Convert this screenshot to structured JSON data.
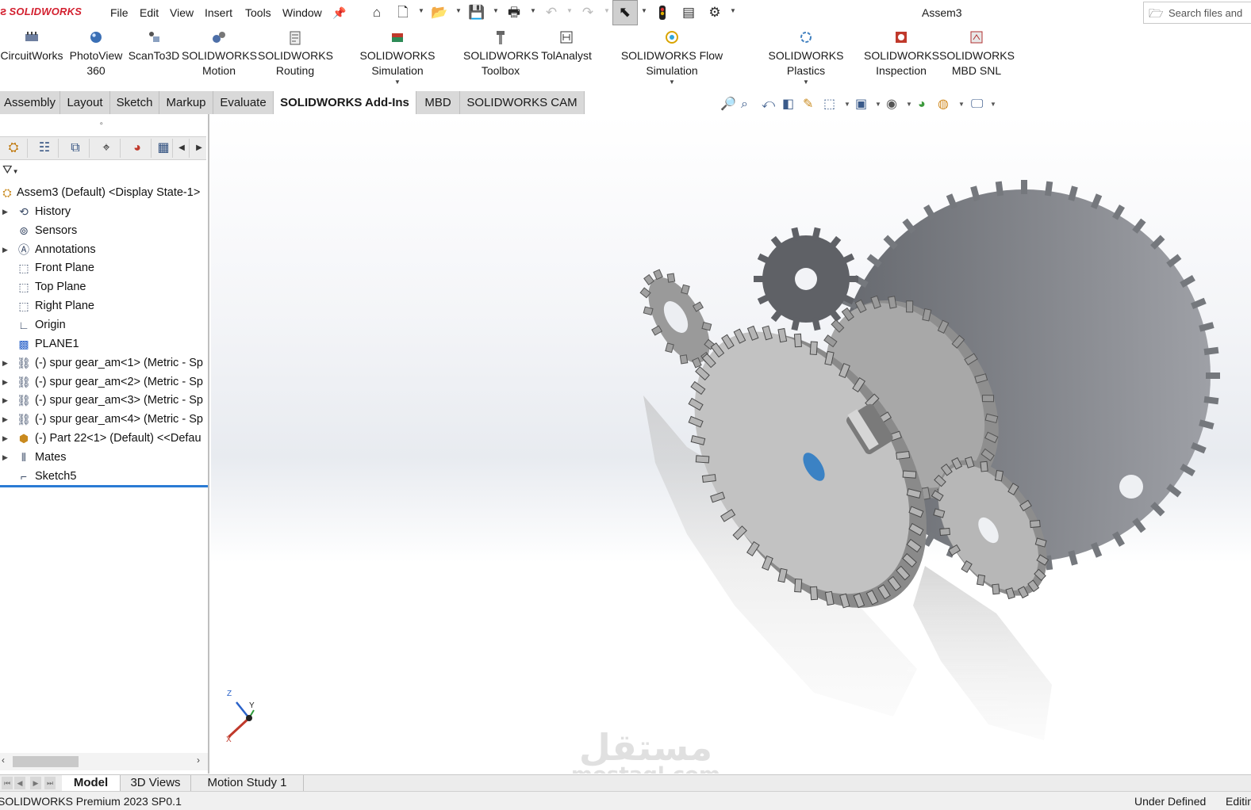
{
  "app": {
    "brand": "SOLIDWORKS",
    "document_title": "Assem3"
  },
  "menu": [
    "File",
    "Edit",
    "View",
    "Insert",
    "Tools",
    "Window"
  ],
  "search": {
    "placeholder": "Search files and"
  },
  "quick_access_icons": [
    "home-icon",
    "new-document-icon",
    "open-folder-icon",
    "save-icon",
    "print-icon",
    "undo-icon",
    "redo-icon",
    "select-cursor-icon",
    "rebuild-icon",
    "file-properties-icon",
    "options-gear-icon"
  ],
  "addins": [
    {
      "line1": "CircuitWorks",
      "line2": "",
      "icon": "circuit-icon"
    },
    {
      "line1": "PhotoView",
      "line2": "360",
      "icon": "photoview-sphere-icon"
    },
    {
      "line1": "ScanTo3D",
      "line2": "",
      "icon": "scan-icon"
    },
    {
      "line1": "SOLIDWORKS",
      "line2": "Motion",
      "icon": "motion-icon"
    },
    {
      "line1": "SOLIDWORKS",
      "line2": "Routing",
      "icon": "routing-icon"
    },
    {
      "line1": "SOLIDWORKS Simulation",
      "line2": "",
      "icon": "simulation-icon"
    },
    {
      "line1": "SOLIDWORKS",
      "line2": "Toolbox",
      "icon": "toolbox-screw-icon"
    },
    {
      "line1": "TolAnalyst",
      "line2": "",
      "icon": "tolanalyst-icon"
    },
    {
      "line1": "SOLIDWORKS Flow Simulation",
      "line2": "",
      "icon": "flow-simulation-icon"
    },
    {
      "line1": "SOLIDWORKS Plastics",
      "line2": "",
      "icon": "plastics-icon"
    },
    {
      "line1": "SOLIDWORKS",
      "line2": "Inspection",
      "icon": "inspection-icon"
    },
    {
      "line1": "SOLIDWORKS",
      "line2": "MBD SNL",
      "icon": "mbd-snl-icon"
    }
  ],
  "tabs": [
    "Assembly",
    "Layout",
    "Sketch",
    "Markup",
    "Evaluate",
    "SOLIDWORKS Add-Ins",
    "MBD",
    "SOLIDWORKS CAM"
  ],
  "active_tab": "SOLIDWORKS Add-Ins",
  "view_toolbar_icons": [
    "zoom-to-fit-icon",
    "zoom-area-icon",
    "previous-view-icon",
    "section-view-icon",
    "dynamic-annotation-icon",
    "view-orientation-icon",
    "display-style-icon",
    "hide-show-items-icon",
    "edit-appearance-icon",
    "apply-scene-icon",
    "view-settings-icon"
  ],
  "panel_tab_icons": [
    "feature-manager-icon",
    "property-manager-icon",
    "configuration-manager-icon",
    "dimxpert-icon",
    "display-manager-icon",
    "cam-manager-icon"
  ],
  "tree": [
    {
      "label": "Assem3 (Default) <Display State-1>",
      "icon": "assembly-icon",
      "expandable": false,
      "root": true
    },
    {
      "label": "History",
      "icon": "history-icon",
      "expandable": true
    },
    {
      "label": "Sensors",
      "icon": "sensors-icon",
      "expandable": false
    },
    {
      "label": "Annotations",
      "icon": "annotations-icon",
      "expandable": true
    },
    {
      "label": "Front Plane",
      "icon": "plane-icon",
      "expandable": false
    },
    {
      "label": "Top Plane",
      "icon": "plane-icon",
      "expandable": false
    },
    {
      "label": "Right Plane",
      "icon": "plane-icon",
      "expandable": false
    },
    {
      "label": "Origin",
      "icon": "origin-icon",
      "expandable": false
    },
    {
      "label": "PLANE1",
      "icon": "plane-blue-icon",
      "expandable": false
    },
    {
      "label": "(-) spur gear_am<1> (Metric - Sp",
      "icon": "toolbox-part-icon",
      "expandable": true
    },
    {
      "label": "(-) spur gear_am<2> (Metric - Sp",
      "icon": "toolbox-part-icon",
      "expandable": true
    },
    {
      "label": "(-) spur gear_am<3> (Metric - Sp",
      "icon": "toolbox-part-icon",
      "expandable": true
    },
    {
      "label": "(-) spur gear_am<4> (Metric - Sp",
      "icon": "toolbox-part-icon",
      "expandable": true
    },
    {
      "label": "(-) Part 22<1> (Default) <<Defau",
      "icon": "part-icon",
      "expandable": true
    },
    {
      "label": "Mates",
      "icon": "mates-icon",
      "expandable": true
    },
    {
      "label": "Sketch5",
      "icon": "sketch-icon",
      "expandable": false
    }
  ],
  "triad": {
    "x": "X",
    "y": "Y",
    "z": "Z"
  },
  "watermark": {
    "arabic": "مستقل",
    "latin": "mostaql.com"
  },
  "bottom_tabs": [
    "Model",
    "3D Views",
    "Motion Study 1"
  ],
  "active_bottom_tab": "Model",
  "status": {
    "left": "SOLIDWORKS Premium 2023 SP0.1",
    "right": "Under Defined",
    "right2": "Editing Assembly"
  },
  "colors": {
    "brand_red": "#d3202f",
    "selection_blue": "#2a7bd4",
    "gear_grey": "#a9a9a9",
    "bore_blue": "#3b82c4"
  }
}
